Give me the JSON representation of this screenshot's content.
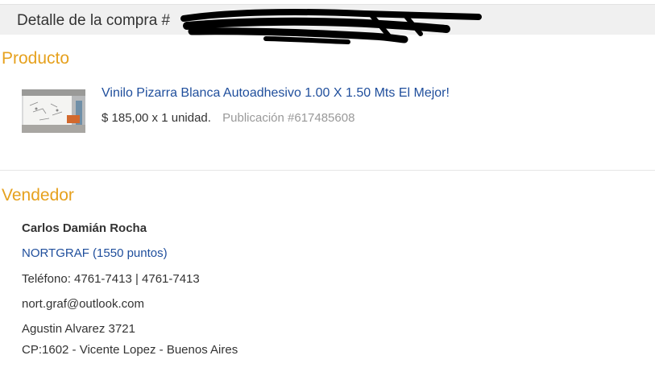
{
  "header": {
    "title": "Detalle de la compra #"
  },
  "product_section": {
    "title": "Producto",
    "item": {
      "name": "Vinilo Pizarra Blanca Autoadhesivo 1.00 X 1.50 Mts El Mejor!",
      "price_qty": "$ 185,00 x 1 unidad.",
      "publication": "Publicación #617485608",
      "thumbnail_icon": "product-thumbnail"
    }
  },
  "seller_section": {
    "title": "Vendedor",
    "name": "Carlos Damián Rocha",
    "nickname": "NORTGRAF (1550 puntos)",
    "phone": "Teléfono: 4761-7413 | 4761-7413",
    "email": "nort.graf@outlook.com",
    "address": "Agustin Alvarez 3721",
    "location": "CP:1602 - Vicente Lopez - Buenos Aires"
  },
  "colors": {
    "section_title": "#e6a11e",
    "link": "#1f4e9c",
    "muted": "#999999",
    "header_bg": "#f0f0f0"
  }
}
